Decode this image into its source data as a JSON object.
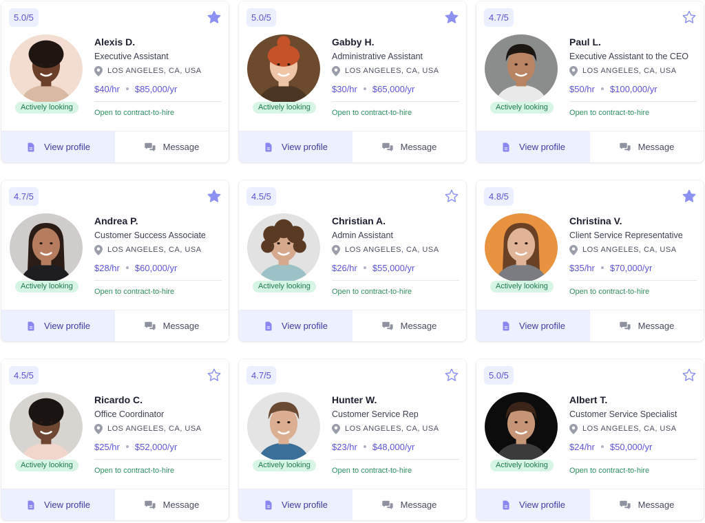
{
  "colors": {
    "accent": "#5b54d6",
    "star": "#8c91f2",
    "status_bg": "#d7f5e4",
    "status_text": "#1d7a4c",
    "contract_text": "#2f8f5f",
    "view_button_bg": "#edf0fe"
  },
  "labels": {
    "view_profile": "View profile",
    "message": "Message",
    "status": "Actively looking",
    "contract": "Open to contract-to-hire"
  },
  "icons": {
    "favorite": "star-icon",
    "location": "map-pin-icon",
    "view_profile": "document-icon",
    "message": "chat-bubbles-icon"
  },
  "candidates": [
    {
      "rating": "5.0/5",
      "favorited": true,
      "name": "Alexis D.",
      "title": "Executive Assistant",
      "location": "LOS ANGELES, CA, USA",
      "hourly": "$40/hr",
      "yearly": "$85,000/yr",
      "avatar": {
        "bg": "#f3ddd0",
        "skin": "#6b3f2a",
        "hair": "#1f1612",
        "shirt": "#d9b9a4",
        "style": "afro"
      }
    },
    {
      "rating": "5.0/5",
      "favorited": true,
      "name": "Gabby H.",
      "title": "Administrative Assistant",
      "location": "LOS ANGELES, CA, USA",
      "hourly": "$30/hr",
      "yearly": "$65,000/yr",
      "avatar": {
        "bg": "#6b4a2e",
        "skin": "#f0c4a6",
        "hair": "#c5532a",
        "shirt": "#4b3523",
        "style": "bun"
      }
    },
    {
      "rating": "4.7/5",
      "favorited": false,
      "name": "Paul L.",
      "title": "Executive Assistant to the CEO",
      "location": "LOS ANGELES, CA, USA",
      "hourly": "$50/hr",
      "yearly": "$100,000/yr",
      "avatar": {
        "bg": "#8a8d8c",
        "skin": "#b98462",
        "hair": "#1c1613",
        "shirt": "#e9e9e9",
        "style": "short"
      }
    },
    {
      "rating": "4.7/5",
      "favorited": true,
      "name": "Andrea P.",
      "title": "Customer Success Associate",
      "location": "LOS ANGELES, CA, USA",
      "hourly": "$28/hr",
      "yearly": "$60,000/yr",
      "avatar": {
        "bg": "#cfcccb",
        "skin": "#b57d5e",
        "hair": "#2b1c16",
        "shirt": "#1d1d22",
        "style": "long"
      }
    },
    {
      "rating": "4.5/5",
      "favorited": false,
      "name": "Christian A.",
      "title": "Admin Assistant",
      "location": "LOS ANGELES, CA, USA",
      "hourly": "$26/hr",
      "yearly": "$55,000/yr",
      "avatar": {
        "bg": "#e2e2e2",
        "skin": "#d7a98c",
        "hair": "#5a3a22",
        "shirt": "#9cc2c8",
        "style": "curly"
      }
    },
    {
      "rating": "4.8/5",
      "favorited": true,
      "name": "Christina V.",
      "title": "Client Service Representative",
      "location": "LOS ANGELES, CA, USA",
      "hourly": "$35/hr",
      "yearly": "$70,000/yr",
      "avatar": {
        "bg": "#e9923f",
        "skin": "#e2b497",
        "hair": "#6a4125",
        "shirt": "#7a7c82",
        "style": "long"
      }
    },
    {
      "rating": "4.5/5",
      "favorited": false,
      "name": "Ricardo C.",
      "title": "Office Coordinator",
      "location": "LOS ANGELES, CA, USA",
      "hourly": "$25/hr",
      "yearly": "$52,000/yr",
      "avatar": {
        "bg": "#d8d4cf",
        "skin": "#6e4631",
        "hair": "#1a1412",
        "shirt": "#f0d6cc",
        "style": "afro"
      }
    },
    {
      "rating": "4.7/5",
      "favorited": false,
      "name": "Hunter W.",
      "title": "Customer Service Rep",
      "location": "LOS ANGELES, CA, USA",
      "hourly": "$23/hr",
      "yearly": "$48,000/yr",
      "avatar": {
        "bg": "#e4e4e4",
        "skin": "#dcae92",
        "hair": "#6b4a33",
        "shirt": "#3a6f9a",
        "style": "short"
      }
    },
    {
      "rating": "5.0/5",
      "favorited": false,
      "name": "Albert T.",
      "title": "Customer Service Specialist",
      "location": "LOS ANGELES, CA, USA",
      "hourly": "$24/hr",
      "yearly": "$50,000/yr",
      "avatar": {
        "bg": "#0c0c0c",
        "skin": "#c69576",
        "hair": "#3a2518",
        "shirt": "#3b3b3b",
        "style": "short"
      }
    }
  ]
}
